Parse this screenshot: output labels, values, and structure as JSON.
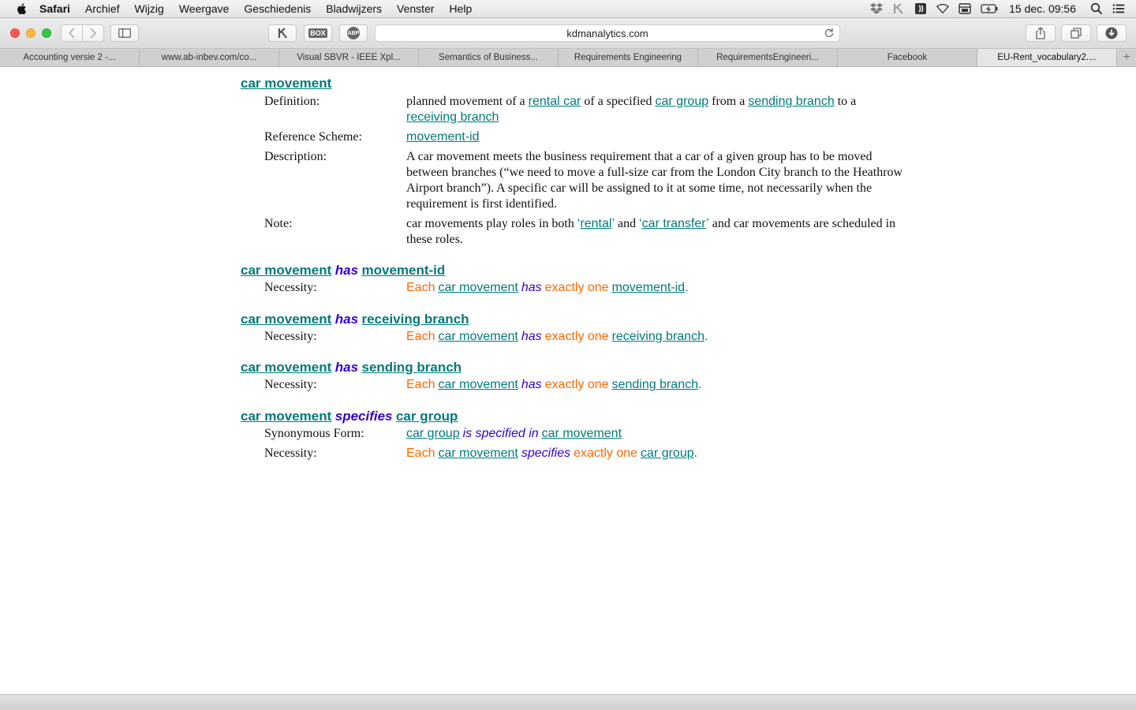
{
  "menubar": {
    "app": "Safari",
    "items": [
      "Archief",
      "Wijzig",
      "Weergave",
      "Geschiedenis",
      "Bladwijzers",
      "Venster",
      "Help"
    ],
    "clock": "15 dec.  09:56"
  },
  "toolbar": {
    "url": "kdmanalytics.com",
    "icons": [
      "back-icon",
      "forward-icon",
      "sidebar-icon",
      "kpi-icon",
      "box-icon",
      "adblock-icon",
      "share-icon",
      "tabs-icon",
      "download-icon"
    ],
    "box_label": "BOX",
    "abp_label": "ABP"
  },
  "tabs": [
    {
      "label": "Accounting versie 2 -...",
      "active": false
    },
    {
      "label": "www.ab-inbev.com/co...",
      "active": false
    },
    {
      "label": "Visual SBVR - IEEE Xpl...",
      "active": false
    },
    {
      "label": "Semantics of Business...",
      "active": false
    },
    {
      "label": "Requirements Engineering",
      "active": false
    },
    {
      "label": "RequirementsEngineeri...",
      "active": false
    },
    {
      "label": "Facebook",
      "active": false
    },
    {
      "label": "EU-Rent_vocabulary2....",
      "active": true
    }
  ],
  "tab_add": "+",
  "content": {
    "e1": {
      "term": "car movement",
      "definition_label": "Definition:",
      "def": {
        "p1": "planned movement of a ",
        "t1": "rental car",
        "p2": " of a specified ",
        "t2": "car group",
        "p3": " from a ",
        "t3": "sending branch",
        "p4": " to a ",
        "t4": "receiving branch"
      },
      "refscheme_label": "Reference Scheme:",
      "refscheme": "movement-id",
      "description_label": "Description:",
      "description": "A car movement meets the business requirement that a car of a given group has to be moved between branches (“we need to move a full-size car from the London City branch to the Heathrow Airport branch”). A specific car will be assigned to it at some time, not necessarily when the requirement is first identified.",
      "note_label": "Note:",
      "note": {
        "p1": "car movements play roles in both ",
        "q1": "‘",
        "t1": "rental",
        "q2": "’",
        "p2": " and ",
        "q3": "‘",
        "t2": "car transfer",
        "q4": "’",
        "p3": " and car movements are scheduled in these roles."
      }
    },
    "e2": {
      "subj": "car movement",
      "verb": "has",
      "obj": "movement-id",
      "necessity_label": "Necessity:",
      "n": {
        "each": "Each",
        "t1": "car movement",
        "v": "has",
        "q": "exactly one",
        "t2": "movement-id",
        "dot": "."
      }
    },
    "e3": {
      "subj": "car movement",
      "verb": "has",
      "obj": "receiving branch",
      "necessity_label": "Necessity:",
      "n": {
        "each": "Each",
        "t1": "car movement",
        "v": "has",
        "q": "exactly one",
        "t2": "receiving branch",
        "dot": "."
      }
    },
    "e4": {
      "subj": "car movement",
      "verb": "has",
      "obj": "sending branch",
      "necessity_label": "Necessity:",
      "n": {
        "each": "Each",
        "t1": "car movement",
        "v": "has",
        "q": "exactly one",
        "t2": "sending branch",
        "dot": "."
      }
    },
    "e5": {
      "subj": "car movement",
      "verb": "specifies",
      "obj": "car group",
      "synonymous_label": "Synonymous Form:",
      "syn": {
        "t1": "car group",
        "v": "is specified in",
        "t2": "car movement"
      },
      "necessity_label": "Necessity:",
      "n": {
        "each": "Each",
        "t1": "car movement",
        "v": "specifies",
        "q": "exactly one",
        "t2": "car group",
        "dot": "."
      }
    }
  },
  "colors": {
    "term": "#007a7a",
    "verb": "#3300cc",
    "keyword": "#ff6600",
    "close": "#fc5753",
    "minimize": "#fdbc40",
    "zoom": "#33c748"
  }
}
